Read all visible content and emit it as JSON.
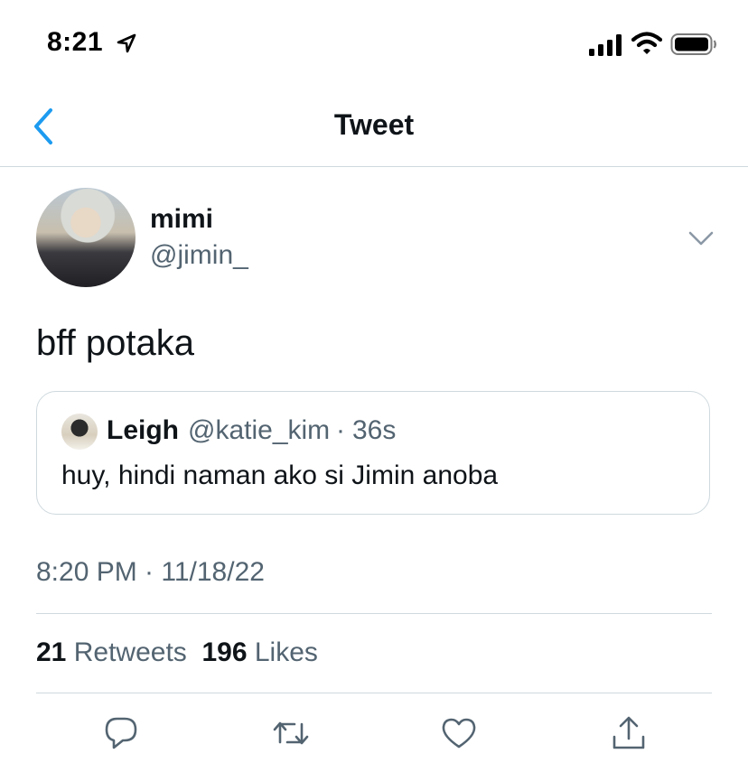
{
  "status_bar": {
    "time": "8:21"
  },
  "nav": {
    "title": "Tweet"
  },
  "tweet": {
    "author_name": "mimi",
    "author_handle": "@jimin_",
    "text": "bff potaka",
    "timestamp": "8:20 PM · 11/18/22",
    "stats": {
      "retweets_count": "21",
      "retweets_label": "Retweets",
      "likes_count": "196",
      "likes_label": "Likes"
    }
  },
  "quote": {
    "name": "Leigh",
    "handle": "@katie_kim",
    "separator": "·",
    "time": "36s",
    "text": "huy, hindi naman ako si Jimin anoba"
  },
  "colors": {
    "accent": "#1d9bf0",
    "secondary_text": "#536471",
    "divider": "#cfd9de"
  },
  "icons": [
    "location-arrow-icon",
    "signal-icon",
    "wifi-icon",
    "battery-icon",
    "back-chevron-icon",
    "chevron-down-icon",
    "reply-icon",
    "retweet-icon",
    "like-icon",
    "share-icon"
  ]
}
